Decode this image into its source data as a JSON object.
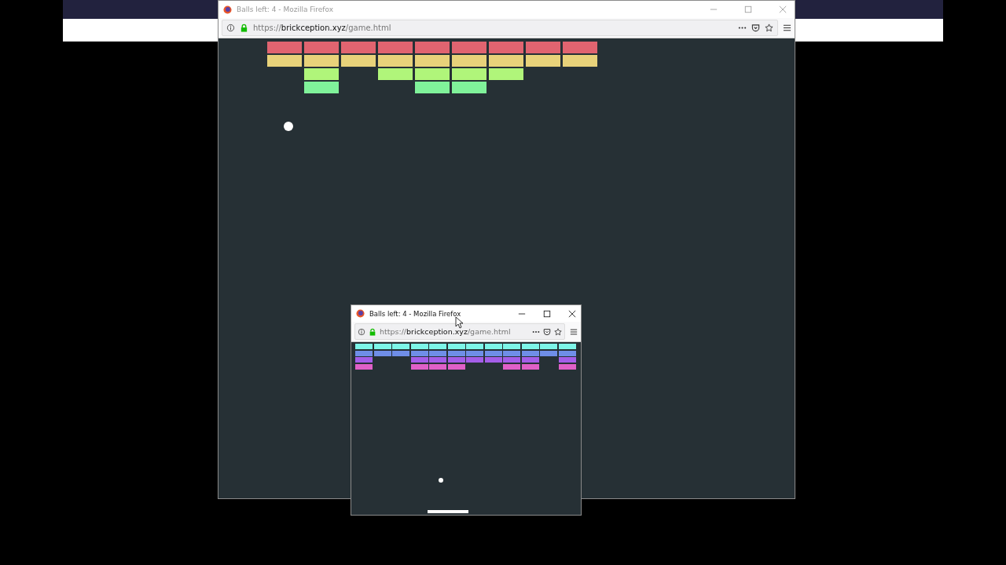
{
  "windows": [
    {
      "kind": "large",
      "active": false,
      "title": "Balls left: 4 - Mozilla Firefox",
      "url": {
        "scheme": "https://",
        "domain": "brickception.xyz",
        "path": "/game.html"
      },
      "brick_rows": [
        {
          "color": "#e06470",
          "bricks": [
            true,
            true,
            true,
            true,
            true,
            true,
            true,
            true,
            true
          ]
        },
        {
          "color": "#e8d27a",
          "bricks": [
            true,
            true,
            true,
            true,
            true,
            true,
            true,
            true,
            true
          ]
        },
        {
          "color": "#b0f57a",
          "bricks": [
            false,
            true,
            false,
            true,
            true,
            true,
            true,
            false,
            false
          ]
        },
        {
          "color": "#80f29a",
          "bricks": [
            false,
            true,
            false,
            false,
            true,
            true,
            false,
            false,
            false
          ]
        }
      ]
    },
    {
      "kind": "small",
      "active": true,
      "title": "Balls left: 4 - Mozilla Firefox",
      "url": {
        "scheme": "https://",
        "domain": "brickception.xyz",
        "path": "/game.html"
      },
      "brick_rows": [
        {
          "color": "#7df5e8",
          "bricks": [
            true,
            true,
            true,
            true,
            true,
            true,
            true,
            true,
            true,
            true,
            true,
            true
          ]
        },
        {
          "color": "#6f8ee8",
          "bricks": [
            true,
            true,
            true,
            true,
            true,
            true,
            true,
            true,
            true,
            true,
            true,
            true
          ]
        },
        {
          "color": "#a45ee8",
          "bricks": [
            true,
            false,
            false,
            true,
            true,
            true,
            true,
            true,
            true,
            true,
            false,
            true
          ]
        },
        {
          "color": "#e060c8",
          "bricks": [
            true,
            false,
            false,
            true,
            true,
            true,
            false,
            false,
            true,
            true,
            false,
            true
          ]
        }
      ]
    }
  ]
}
